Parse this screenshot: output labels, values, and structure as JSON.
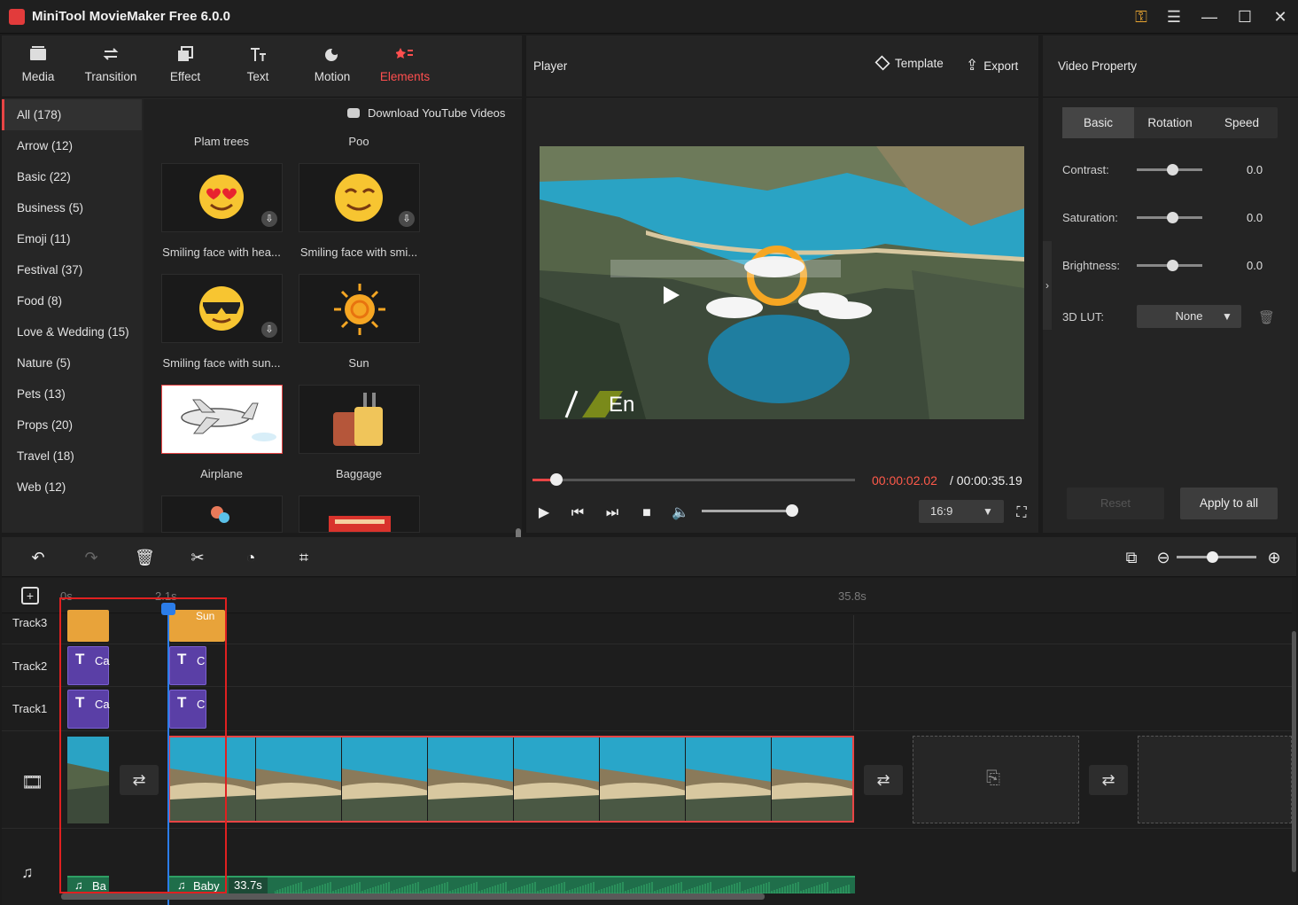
{
  "app": {
    "title": "MiniTool MovieMaker Free 6.0.0"
  },
  "nav": [
    {
      "label": "Media",
      "icon": "media-icon"
    },
    {
      "label": "Transition",
      "icon": "transition-icon"
    },
    {
      "label": "Effect",
      "icon": "effect-icon"
    },
    {
      "label": "Text",
      "icon": "text-icon"
    },
    {
      "label": "Motion",
      "icon": "motion-icon"
    },
    {
      "label": "Elements",
      "icon": "elements-icon",
      "active": true
    }
  ],
  "categories": [
    "All (178)",
    "Arrow (12)",
    "Basic (22)",
    "Business (5)",
    "Emoji (11)",
    "Festival (37)",
    "Food (8)",
    "Love & Wedding (15)",
    "Nature (5)",
    "Pets (13)",
    "Props (20)",
    "Travel (18)",
    "Web (12)"
  ],
  "download_youtube": "Download YouTube Videos",
  "elements": {
    "top_labels": [
      "Plam trees",
      "Poo"
    ],
    "items": [
      {
        "label": "Smiling face with hea..."
      },
      {
        "label": "Smiling face with smi..."
      },
      {
        "label": "Smiling face with sun..."
      },
      {
        "label": "Sun"
      },
      {
        "label": "Airplane"
      },
      {
        "label": "Baggage"
      }
    ]
  },
  "player": {
    "title": "Player",
    "template": "Template",
    "export": "Export",
    "overlay_text": "En",
    "time_current": "00:00:02.02",
    "time_total": "/ 00:00:35.19",
    "ratio": "16:9",
    "progress": 0.06,
    "volume": 0.9
  },
  "property": {
    "title": "Video Property",
    "tabs": [
      "Basic",
      "Rotation",
      "Speed"
    ],
    "contrast_label": "Contrast:",
    "contrast_value": "0.0",
    "saturation_label": "Saturation:",
    "saturation_value": "0.0",
    "brightness_label": "Brightness:",
    "brightness_value": "0.0",
    "lut_label": "3D LUT:",
    "lut_value": "None",
    "reset": "Reset",
    "apply": "Apply to all"
  },
  "timeline": {
    "ruler": [
      "0s",
      "2.1s",
      "35.8s"
    ],
    "tracks": [
      "Track3",
      "Track2",
      "Track1"
    ],
    "clip_sun_label": "Sun",
    "clip_text_a": "Ca",
    "clip_text_b": "C",
    "audio_a": "Ba",
    "audio_b": "Baby",
    "audio_duration": "33.7s"
  },
  "colors": {
    "accent": "#e84545",
    "playhead": "#2b7de9",
    "text_clip": "#5a3fa6",
    "sticker_clip": "#e8a33a",
    "audio_clip": "#1f6e4a"
  }
}
